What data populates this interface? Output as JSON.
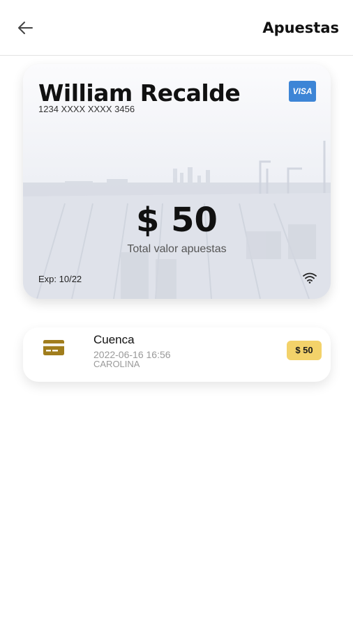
{
  "header": {
    "title": "Apuestas",
    "back_icon": "arrow-left-icon"
  },
  "card": {
    "holder_name": "William Recalde",
    "number": "1234 XXXX XXXX 3456",
    "brand": "VISA",
    "total": "$ 50",
    "total_label": "Total valor apuestas",
    "expiry": "Exp: 10/22",
    "contactless_icon": "wifi-icon"
  },
  "bets": [
    {
      "title": "Cuenca",
      "datetime": "2022-06-16 16:56",
      "user": "CAROLINA",
      "amount": "$ 50",
      "icon": "credit-card-icon",
      "badge_color": "#f3d26a"
    }
  ],
  "colors": {
    "accent": "#f3d26a",
    "icon": "#a07d1c",
    "visa": "#3d85d6"
  }
}
